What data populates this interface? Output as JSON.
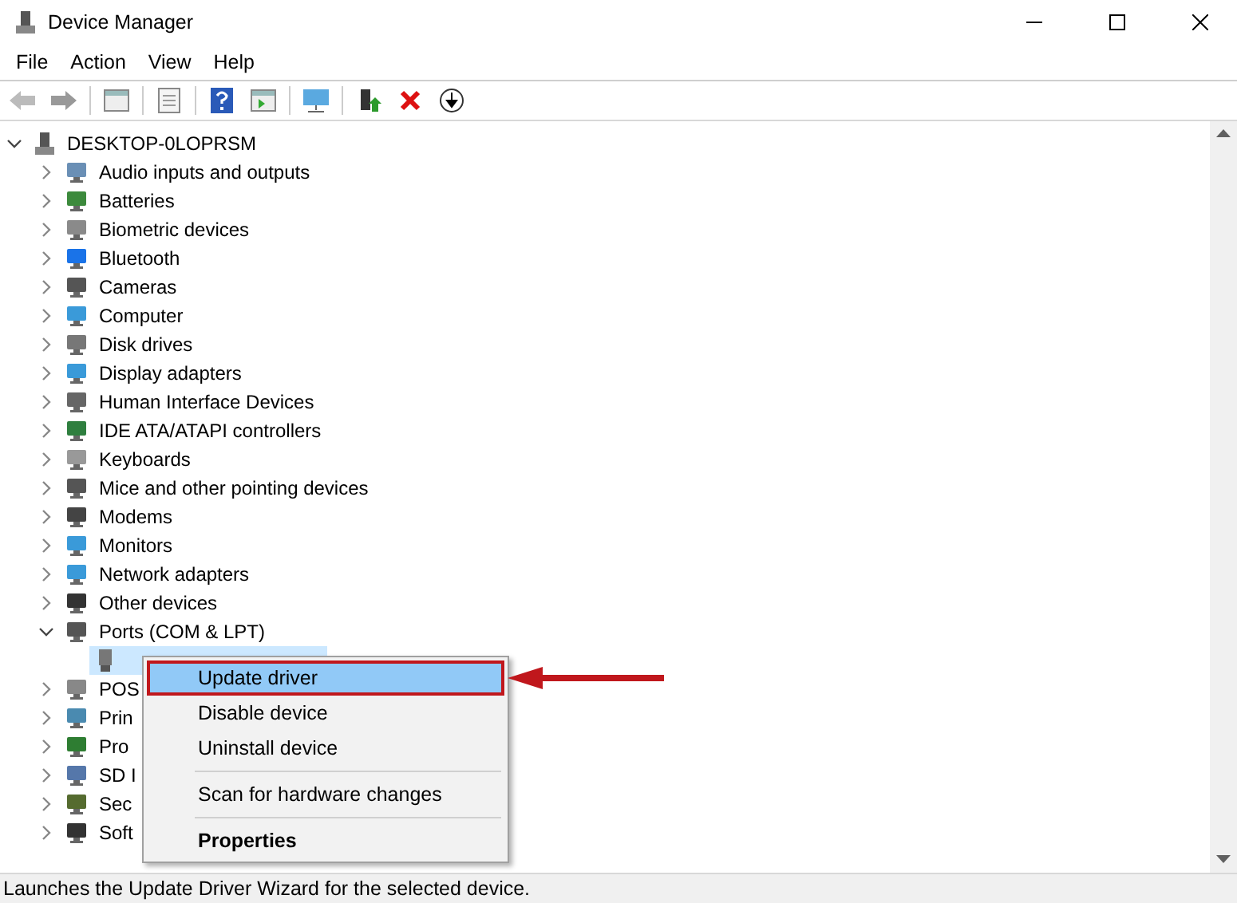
{
  "window": {
    "title": "Device Manager"
  },
  "menu_bar": [
    "File",
    "Action",
    "View",
    "Help"
  ],
  "tree": {
    "label": "DESKTOP-0LOPRSM",
    "expanded": true,
    "selected": false,
    "children": [
      {
        "label": "Audio inputs and outputs",
        "expanded": false,
        "selected": false
      },
      {
        "label": "Batteries",
        "expanded": false,
        "selected": false
      },
      {
        "label": "Biometric devices",
        "expanded": false,
        "selected": false
      },
      {
        "label": "Bluetooth",
        "expanded": false,
        "selected": false
      },
      {
        "label": "Cameras",
        "expanded": false,
        "selected": false
      },
      {
        "label": "Computer",
        "expanded": false,
        "selected": false
      },
      {
        "label": "Disk drives",
        "expanded": false,
        "selected": false
      },
      {
        "label": "Display adapters",
        "expanded": false,
        "selected": false
      },
      {
        "label": "Human Interface Devices",
        "expanded": false,
        "selected": false
      },
      {
        "label": "IDE ATA/ATAPI controllers",
        "expanded": false,
        "selected": false
      },
      {
        "label": "Keyboards",
        "expanded": false,
        "selected": false
      },
      {
        "label": "Mice and other pointing devices",
        "expanded": false,
        "selected": false
      },
      {
        "label": "Modems",
        "expanded": false,
        "selected": false
      },
      {
        "label": "Monitors",
        "expanded": false,
        "selected": false
      },
      {
        "label": "Network adapters",
        "expanded": false,
        "selected": false
      },
      {
        "label": "Other devices",
        "expanded": false,
        "selected": false
      },
      {
        "label": "Ports (COM & LPT)",
        "expanded": true,
        "selected": false,
        "children": [
          {
            "selected": true
          }
        ]
      },
      {
        "label": "POS",
        "expanded": false,
        "selected": false
      },
      {
        "label": "Prin",
        "expanded": false,
        "selected": false
      },
      {
        "label": "Pro",
        "expanded": false,
        "selected": false
      },
      {
        "label": "SD I",
        "expanded": false,
        "selected": false
      },
      {
        "label": "Sec",
        "expanded": false,
        "selected": false
      },
      {
        "label": "Soft",
        "expanded": false,
        "selected": false
      }
    ]
  },
  "context_menu": [
    {
      "kind": "item",
      "label": "Update driver",
      "selected": true,
      "default": false
    },
    {
      "kind": "item",
      "label": "Disable device",
      "selected": false,
      "default": false
    },
    {
      "kind": "item",
      "label": "Uninstall device",
      "selected": false,
      "default": false
    },
    {
      "kind": "separator"
    },
    {
      "kind": "item",
      "label": "Scan for hardware changes",
      "selected": false,
      "default": false
    },
    {
      "kind": "separator"
    },
    {
      "kind": "item",
      "label": "Properties",
      "selected": false,
      "default": true
    }
  ],
  "status_bar": "Launches the Update Driver Wizard for the selected device."
}
